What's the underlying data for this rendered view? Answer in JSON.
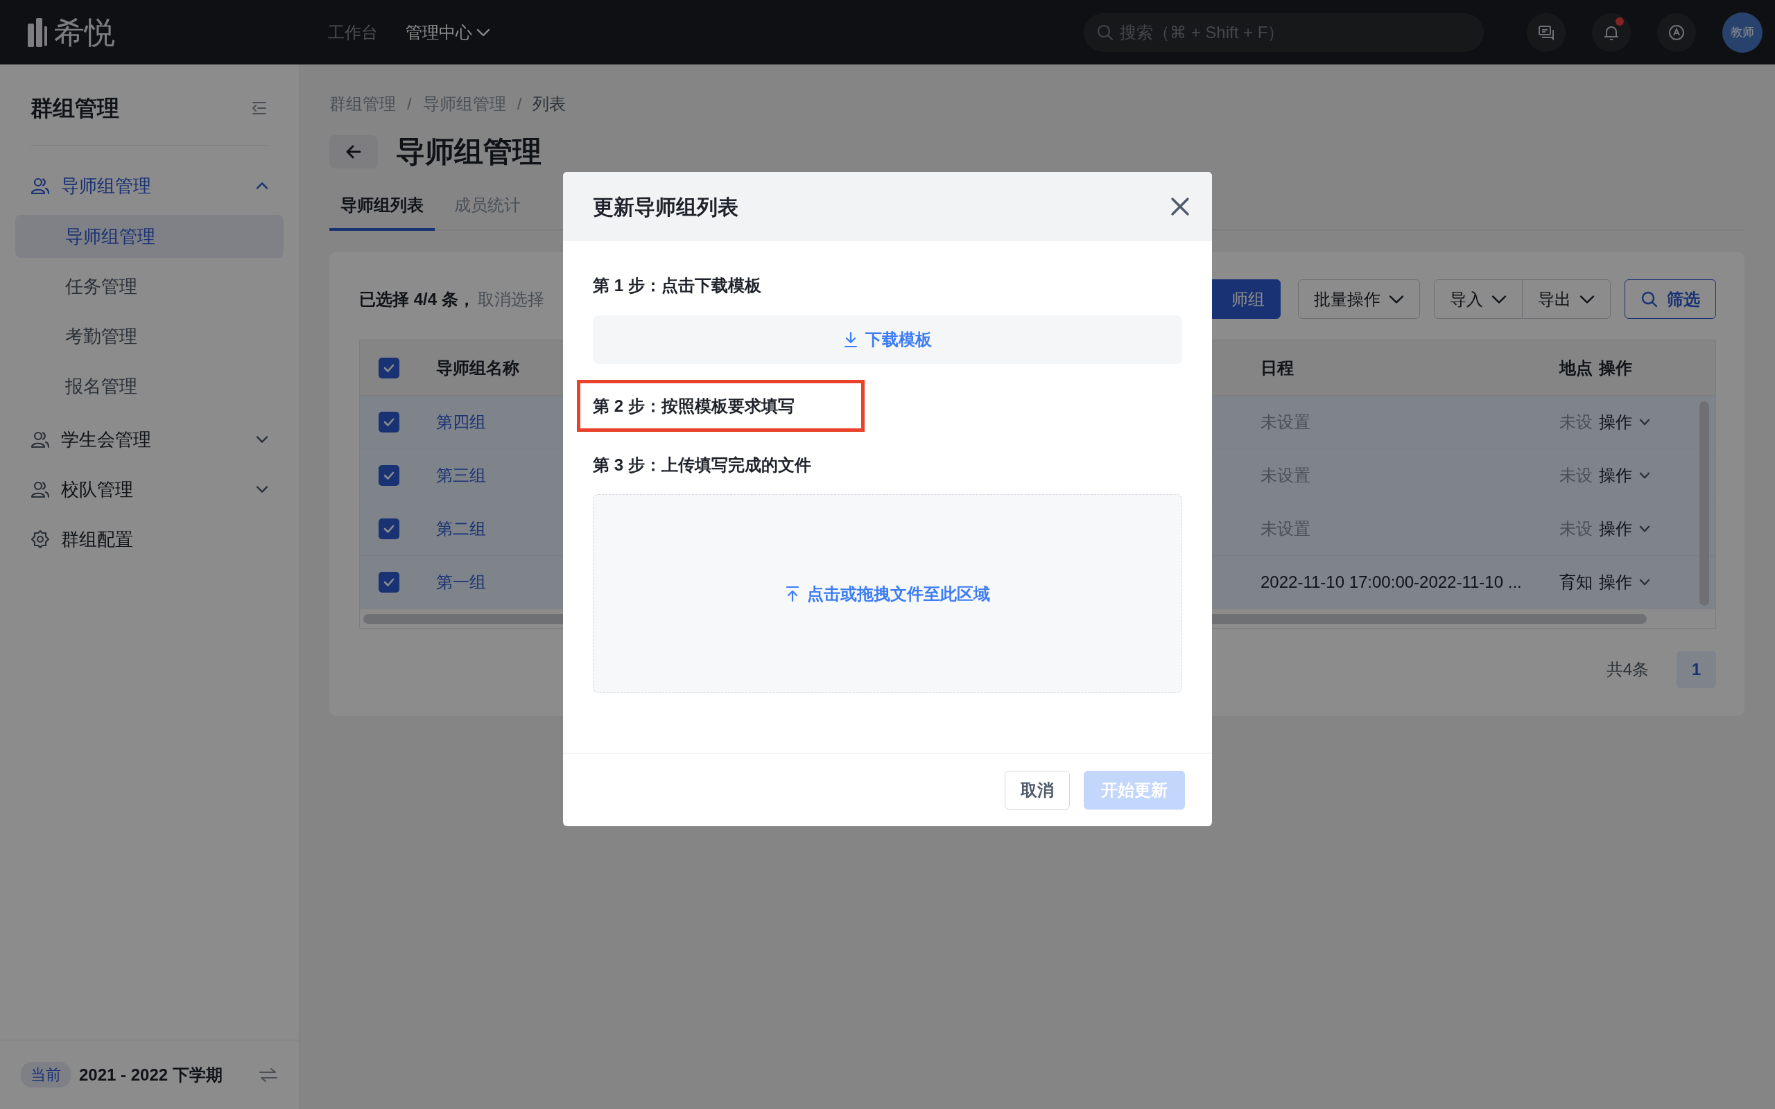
{
  "topbar": {
    "logo": "希悦",
    "nav": [
      {
        "label": "工作台",
        "selected": false,
        "dropdown": false
      },
      {
        "label": "管理中心",
        "selected": true,
        "dropdown": true
      }
    ],
    "search": {
      "placeholder": "搜索（⌘ + Shift + F）"
    },
    "notification_dot": true,
    "avatar": "教师"
  },
  "sidebar": {
    "title": "群组管理",
    "items": [
      {
        "label": "导师组管理",
        "kind": "group",
        "selected": true,
        "expanded": true,
        "children": [
          {
            "label": "导师组管理",
            "selected": true
          },
          {
            "label": "任务管理",
            "selected": false
          },
          {
            "label": "考勤管理",
            "selected": false
          },
          {
            "label": "报名管理",
            "selected": false
          }
        ]
      },
      {
        "label": "学生会管理",
        "kind": "group",
        "selected": false,
        "expanded": false
      },
      {
        "label": "校队管理",
        "kind": "group",
        "selected": false,
        "expanded": false
      },
      {
        "label": "群组配置",
        "kind": "settings",
        "selected": false
      }
    ],
    "term": {
      "badge": "当前",
      "label": "2021 - 2022 下学期"
    }
  },
  "breadcrumb": {
    "items": [
      "群组管理",
      "导师组管理",
      "列表"
    ],
    "separator": "/"
  },
  "page_title": "导师组管理",
  "tabs": [
    {
      "label": "导师组列表",
      "selected": true
    },
    {
      "label": "成员统计",
      "selected": false
    }
  ],
  "selection": {
    "text": "已选择 4/4 条，",
    "cancel": "取消选择"
  },
  "toolbar": [
    {
      "label": "师组",
      "kind": "primary"
    },
    {
      "label": "批量操作",
      "kind": "dropdown"
    },
    {
      "label": "导入",
      "kind": "split"
    },
    {
      "label": "导出",
      "kind": "split"
    },
    {
      "label": "筛选",
      "kind": "filter"
    }
  ],
  "table": {
    "all_checked": true,
    "columns": [
      "导师组名称",
      "日程",
      "地点",
      "操作"
    ],
    "rows": [
      {
        "checked": true,
        "name": "第四组",
        "schedule": {
          "text": "未设置",
          "muted": true
        },
        "place": {
          "text": "未设",
          "muted": true
        },
        "action": "操作"
      },
      {
        "checked": true,
        "name": "第三组",
        "schedule": {
          "text": "未设置",
          "muted": true
        },
        "place": {
          "text": "未设",
          "muted": true
        },
        "action": "操作"
      },
      {
        "checked": true,
        "name": "第二组",
        "schedule": {
          "text": "未设置",
          "muted": true
        },
        "place": {
          "text": "未设",
          "muted": true
        },
        "action": "操作"
      },
      {
        "checked": true,
        "name": "第一组",
        "schedule": {
          "text": "2022-11-10 17:00:00-2022-11-10 ...",
          "muted": false
        },
        "place": {
          "text": "育知",
          "muted": false
        },
        "action": "操作"
      }
    ]
  },
  "pagination": {
    "total": "共4条",
    "pages": [
      {
        "label": "1",
        "selected": true
      }
    ]
  },
  "modal": {
    "title": "更新导师组列表",
    "steps": [
      {
        "kind": "download",
        "label": "第 1 步：点击下载模板",
        "action": "下载模板",
        "highlighted": false
      },
      {
        "kind": "text",
        "label": "第 2 步：按照模板要求填写",
        "highlighted": true
      },
      {
        "kind": "upload",
        "label": "第 3 步：上传填写完成的文件",
        "action": "点击或拖拽文件至此区域",
        "highlighted": false
      }
    ],
    "buttons": [
      {
        "label": "取消",
        "kind": "secondary",
        "disabled": false
      },
      {
        "label": "开始更新",
        "kind": "primary",
        "disabled": true
      }
    ]
  }
}
